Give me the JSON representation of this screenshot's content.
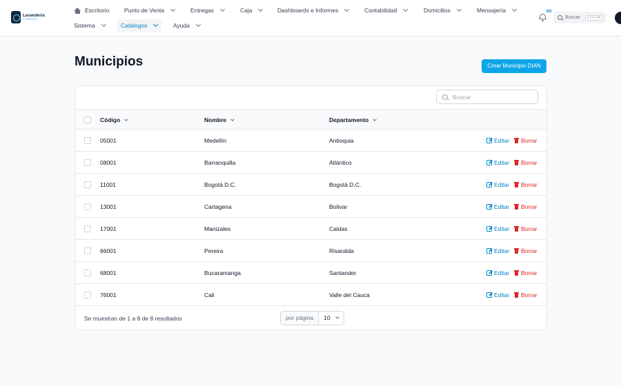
{
  "brand": {
    "name_line1": "Lavandería",
    "name_line2": "AURORA"
  },
  "nav": {
    "row1": [
      {
        "label": "Escritorio",
        "has_icon": "home-icon"
      },
      {
        "label": "Punto de Venta"
      },
      {
        "label": "Entregas"
      },
      {
        "label": "Caja"
      },
      {
        "label": "Dashboards e Informes"
      },
      {
        "label": "Contabilidad"
      },
      {
        "label": "Domicilios"
      },
      {
        "label": "Mensajería"
      }
    ],
    "row2": [
      {
        "label": "Sistema"
      },
      {
        "label": "Catálogos",
        "active": true
      },
      {
        "label": "Ayuda"
      }
    ]
  },
  "notifications": {
    "count": "63",
    "icon": "bell-icon"
  },
  "global_search": {
    "placeholder": "Buscar",
    "shortcut": "Ctrl+K"
  },
  "page": {
    "title": "Municipios",
    "create_button": "Crear Municipio DIAN"
  },
  "table": {
    "search_placeholder": "Buscar",
    "columns": [
      "Código",
      "Nombre",
      "Departamento"
    ],
    "rows": [
      {
        "codigo": "05001",
        "nombre": "Medellín",
        "departamento": "Antioquia"
      },
      {
        "codigo": "08001",
        "nombre": "Barranquilla",
        "departamento": "Atlántico"
      },
      {
        "codigo": "11001",
        "nombre": "Bogotá D.C.",
        "departamento": "Bogotá D.C."
      },
      {
        "codigo": "13001",
        "nombre": "Cartagena",
        "departamento": "Bolívar"
      },
      {
        "codigo": "17001",
        "nombre": "Manizales",
        "departamento": "Caldas"
      },
      {
        "codigo": "66001",
        "nombre": "Pereira",
        "departamento": "Risaralda"
      },
      {
        "codigo": "68001",
        "nombre": "Bucaramanga",
        "departamento": "Santander"
      },
      {
        "codigo": "76001",
        "nombre": "Cali",
        "departamento": "Valle del Cauca"
      }
    ],
    "edit_label": "Editar",
    "delete_label": "Borrar",
    "footer_text": "Se muestran de 1 a 8 de 8 resultados",
    "per_page_label": "por página",
    "per_page_value": "10"
  },
  "colors": {
    "accent": "#0ea5e9",
    "link": "#0284c7",
    "danger": "#dc2626"
  }
}
